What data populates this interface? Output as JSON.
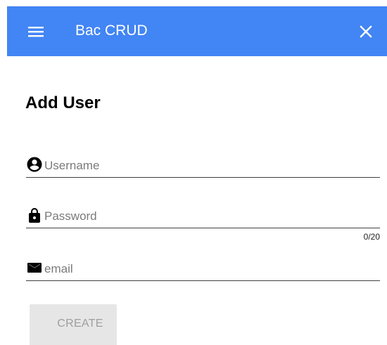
{
  "app": {
    "title": "Bac CRUD",
    "accent_color": "#4285f4",
    "menu_icon": "hamburger-menu-icon",
    "close_icon": "close-icon"
  },
  "form": {
    "title": "Add User",
    "fields": {
      "username": {
        "value": "",
        "placeholder": "Username",
        "icon": "account-circle-icon"
      },
      "password": {
        "value": "",
        "placeholder": "Password",
        "icon": "lock-icon",
        "counter": "0/20"
      },
      "email": {
        "value": "",
        "placeholder": "email",
        "icon": "mail-icon"
      }
    },
    "submit": {
      "label": "CREATE",
      "state": "disabled"
    }
  }
}
